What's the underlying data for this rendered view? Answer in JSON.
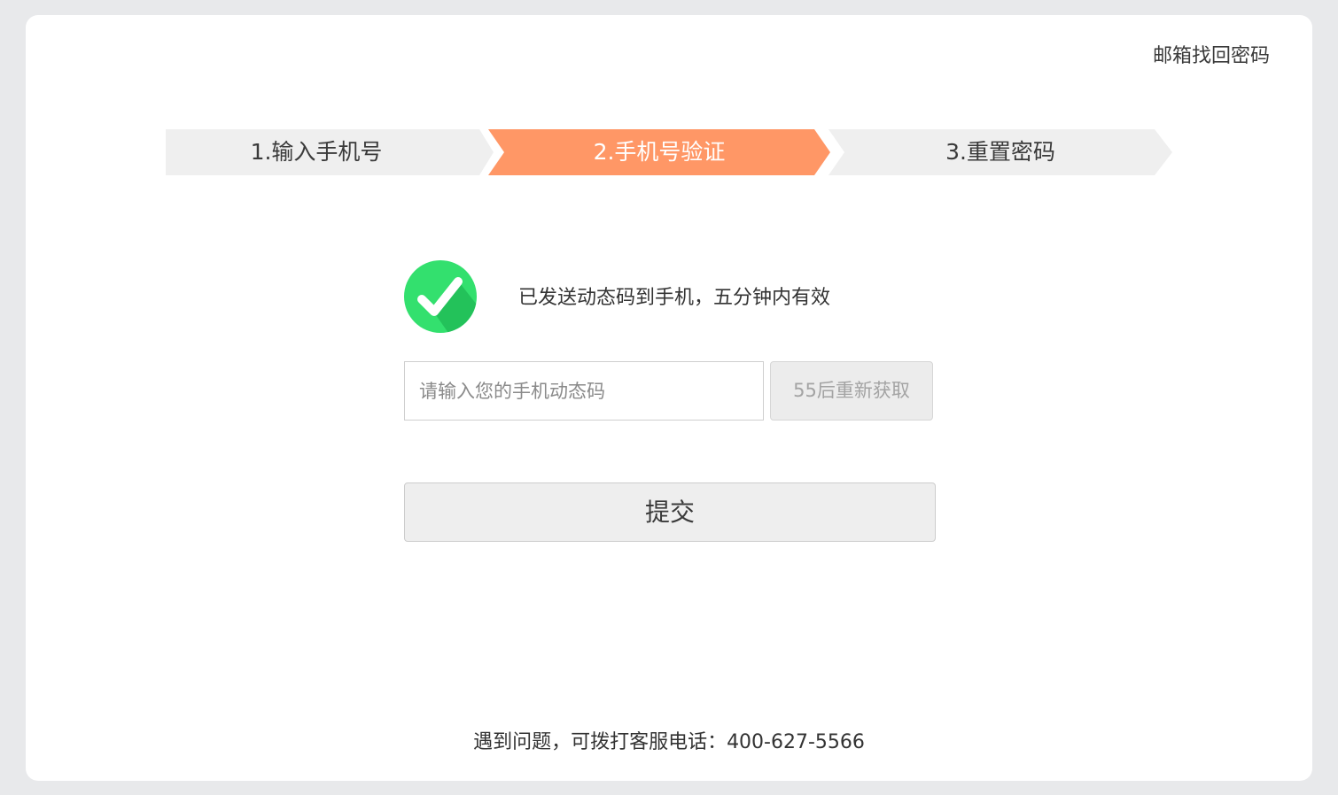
{
  "header": {
    "email_recovery_link": "邮箱找回密码"
  },
  "steps": [
    {
      "label": "1.输入手机号",
      "state": "completed"
    },
    {
      "label": "2.手机号验证",
      "state": "active"
    },
    {
      "label": "3.重置密码",
      "state": "pending"
    }
  ],
  "status": {
    "icon": "check-circle-icon",
    "message": "已发送动态码到手机，五分钟内有效"
  },
  "form": {
    "code_input_placeholder": "请输入您的手机动态码",
    "code_input_value": "",
    "resend_button_label": "55后重新获取",
    "submit_button_label": "提交"
  },
  "footer": {
    "support_text": "遇到问题，可拨打客服电话：400-627-5566"
  },
  "colors": {
    "active_step": "#ff9766",
    "inactive_step": "#efefef",
    "success_green": "#2fd669",
    "page_background": "#e8e9eb"
  }
}
